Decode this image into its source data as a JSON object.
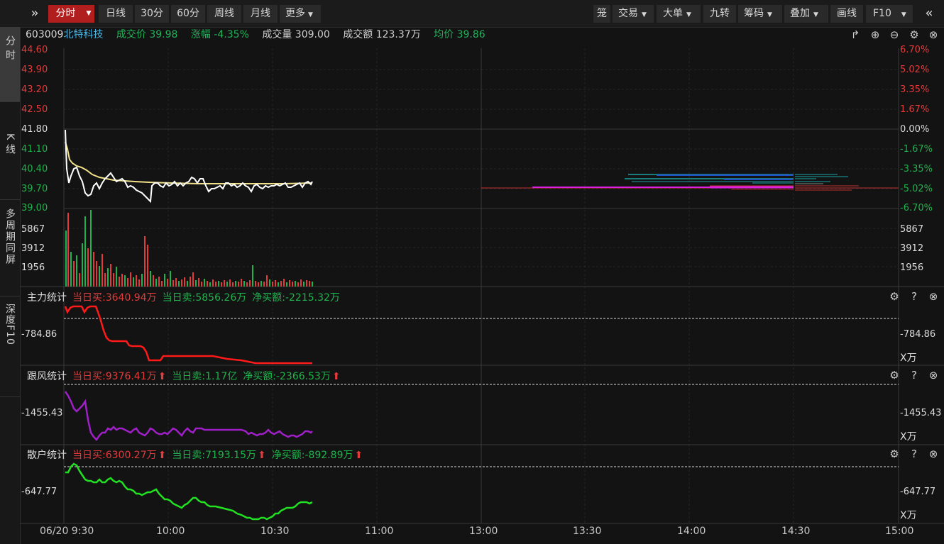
{
  "toolbar": {
    "expand_icon": "double-chevron-right-icon",
    "period_buttons": [
      "分时",
      "日线",
      "30分",
      "60分",
      "周线",
      "月线",
      "更多"
    ],
    "active_period": "分时",
    "right_buttons": [
      "笼",
      "交易",
      "大单",
      "九转",
      "筹码",
      "叠加",
      "画线",
      "F10"
    ],
    "collapse_icon": "double-chevron-left-icon"
  },
  "left_tabs": [
    "分时",
    "K线",
    "多周期同屏",
    "深度F10"
  ],
  "stock": {
    "code": "603009",
    "name": "北特科技",
    "price_label": "成交价",
    "price": "39.98",
    "change_label": "涨幅",
    "change": "-4.35%",
    "volume_label": "成交量",
    "volume": "309.00",
    "amount_label": "成交额",
    "amount": "123.37万",
    "avg_label": "均价",
    "avg": "39.86"
  },
  "header_icons": [
    "share-icon",
    "zoom-in-icon",
    "zoom-out-icon",
    "settings-icon",
    "close-icon"
  ],
  "price_axis": {
    "left": [
      "44.60",
      "43.90",
      "43.20",
      "42.50",
      "41.80",
      "41.10",
      "40.40",
      "39.70",
      "39.00"
    ],
    "right": [
      "6.70%",
      "5.02%",
      "3.35%",
      "1.67%",
      "0.00%",
      "-1.67%",
      "-3.35%",
      "-5.02%",
      "-6.70%"
    ]
  },
  "volume_axis": [
    "5867",
    "3912",
    "1956"
  ],
  "panels": [
    {
      "title": "主力统计",
      "buy_label": "当日买:",
      "buy": "3640.94万",
      "sell_label": "当日卖:",
      "sell": "5856.26万",
      "net_label": "净买额:",
      "net": "-2215.32万",
      "axis": "-784.86",
      "unit": "X万",
      "line_color": "#ff1a1a",
      "arrows": false
    },
    {
      "title": "跟风统计",
      "buy_label": "当日买:",
      "buy": "9376.41万",
      "sell_label": "当日卖:",
      "sell": "1.17亿",
      "net_label": "净买额:",
      "net": "-2366.53万",
      "axis": "-1455.43",
      "unit": "X万",
      "line_color": "#a020c8",
      "arrows": true
    },
    {
      "title": "散户统计",
      "buy_label": "当日买:",
      "buy": "6300.27万",
      "sell_label": "当日卖:",
      "sell": "7193.15万",
      "net_label": "净买额:",
      "net": "-892.89万",
      "axis": "-647.77",
      "unit": "X万",
      "line_color": "#22e022",
      "arrows": true
    }
  ],
  "time_axis": [
    "06/20 9:30",
    "10:00",
    "10:30",
    "11:00",
    "13:00",
    "13:30",
    "14:00",
    "14:30",
    "15:00"
  ],
  "colors": {
    "up": "#e23b3b",
    "down": "#1fb34d",
    "price_line": "#ffffff",
    "avg_line": "#f0e08a",
    "toolbar_active": "#b01e1e"
  }
}
